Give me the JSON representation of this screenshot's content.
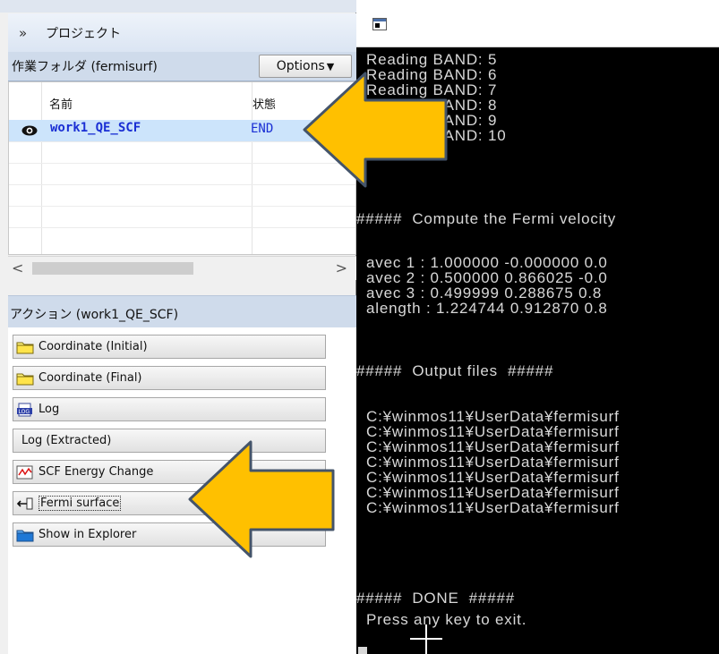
{
  "project_panel": {
    "collapse_icon": "double-chevron-down-icon",
    "title": "プロジェクト",
    "folder_label": "作業フォルダ (fermisurf)",
    "options_label": "Options",
    "options_arrow": "▼",
    "columns": {
      "name": "名前",
      "status": "状態"
    },
    "rows": [
      {
        "icon": "eye-icon",
        "name": "work1_QE_SCF",
        "status": "END"
      }
    ],
    "scroll_left": "<",
    "scroll_right": ">"
  },
  "actions_panel": {
    "title": "アクション (work1_QE_SCF)",
    "items": [
      {
        "label": "Coordinate (Initial)",
        "icon": "folder-icon"
      },
      {
        "label": "Coordinate (Final)",
        "icon": "folder-icon"
      },
      {
        "label": "Log",
        "icon": "log-file-icon"
      },
      {
        "label": "Log (Extracted)",
        "icon": ""
      },
      {
        "label": "SCF Energy Change",
        "icon": "line-chart-icon"
      },
      {
        "label": "Fermi surface",
        "icon": "import-arrow-icon"
      },
      {
        "label": "Show in Explorer",
        "icon": "blue-folder-icon"
      }
    ]
  },
  "console": {
    "window_icon": "console-window-icon",
    "lines": [
      "  Reading BAND: 5",
      "  Reading BAND: 6",
      "  Reading BAND: 7",
      "  Reading BAND: 8",
      "  Reading BAND: 9",
      "  Reading BAND: 10",
      "",
      "#####  Compute the Fermi velocity",
      "",
      "  avec 1 : 1.000000 -0.000000 0.0",
      "  avec 2 : 0.500000 0.866025 -0.0",
      "  avec 3 : 0.499999 0.288675 0.8",
      "  alength : 1.224744 0.912870 0.8",
      "",
      "#####  Output files  #####",
      "",
      "  C:¥winmos11¥UserData¥fermisurf",
      "  C:¥winmos11¥UserData¥fermisurf",
      "  C:¥winmos11¥UserData¥fermisurf",
      "  C:¥winmos11¥UserData¥fermisurf",
      "  C:¥winmos11¥UserData¥fermisurf",
      "  C:¥winmos11¥UserData¥fermisurf",
      "  C:¥winmos11¥UserData¥fermisurf",
      "",
      "#####  DONE  #####",
      "  Press any key to exit."
    ]
  },
  "colors": {
    "arrow_fill": "#FFC000",
    "arrow_stroke": "#44546A",
    "selected_row": "#CCE4FB",
    "link_text": "#1A2FD4",
    "console_bg": "#000000",
    "console_text": "#D8D8D8"
  }
}
